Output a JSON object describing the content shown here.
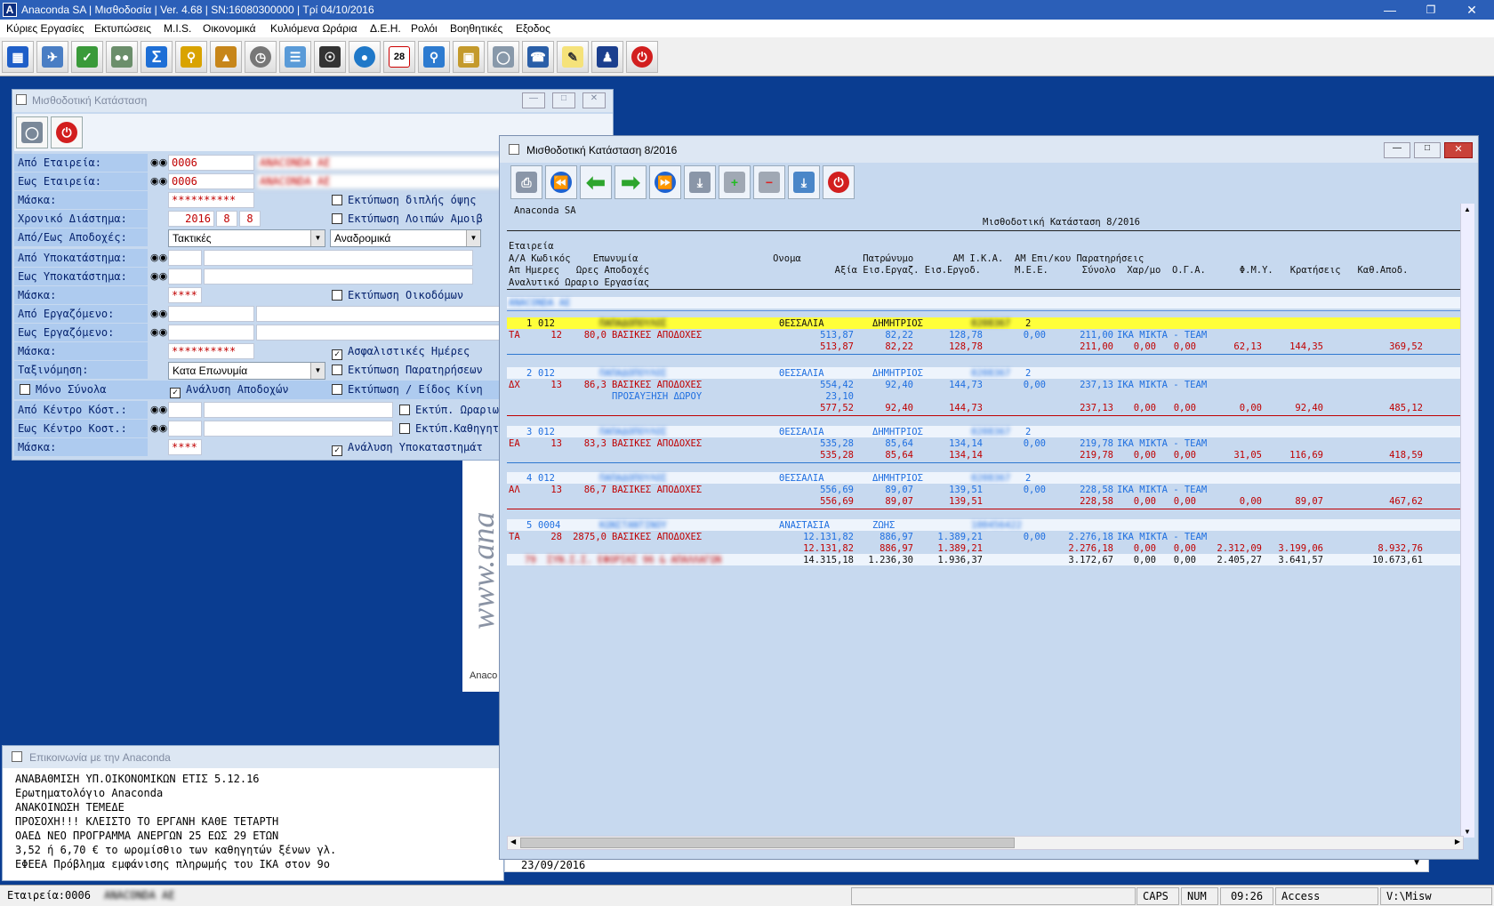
{
  "window": {
    "title": "Anaconda SA | Μισθοδοσία | Ver. 4.68 | SN:16080300000 | Τρί 04/10/2016",
    "app_icon": "A"
  },
  "menu": [
    "Κύριες Εργασίες",
    "Εκτυπώσεις",
    "M.I.S.",
    "Οικονομικά",
    "Κυλιόμενα Ωράρια",
    "Δ.Ε.Η.",
    "Ρολόι",
    "Βοηθητικές",
    "Εξοδος"
  ],
  "toolbar_icons": [
    "building-icon",
    "plane-icon",
    "checklist-icon",
    "users-icon",
    "sigma-icon",
    "key-icon",
    "pyramid-icon",
    "clock-icon",
    "book-icon",
    "headphones-icon",
    "globe-icon",
    "calendar-icon",
    "monitor-search-icon",
    "lock-icon",
    "database-globe-icon",
    "user-phone-icon",
    "notepad-icon",
    "stamp-user-icon",
    "power-icon"
  ],
  "calendar_day": "28",
  "form": {
    "title": "Μισθοδοτική Κατάσταση",
    "fields": {
      "from_company": {
        "label": "Από Εταιρεία:",
        "code": "0006",
        "name": "ANACONDA AE"
      },
      "to_company": {
        "label": "Εως Εταιρεία:",
        "code": "0006",
        "name": "ANACONDA AE"
      },
      "mask1": {
        "label": "Μάσκα:",
        "value": "**********"
      },
      "period": {
        "label": "Χρονικό Διάστημα:",
        "year": "2016",
        "m1": "8",
        "m2": "8"
      },
      "earnings": {
        "label": "Από/Εως Αποδοχές:",
        "sel1": "Τακτικές",
        "sel2": "Αναδρομικά"
      },
      "from_branch": {
        "label": "Από Υποκατάστημα:"
      },
      "to_branch": {
        "label": "Εως Υποκατάστημα:"
      },
      "mask2": {
        "label": "Μάσκα:",
        "value": "****"
      },
      "from_employee": {
        "label": "Από Εργαζόμενο:"
      },
      "to_employee": {
        "label": "Εως Εργαζόμενο:"
      },
      "mask3": {
        "label": "Μάσκα:",
        "value": "**********"
      },
      "sort": {
        "label": "Ταξινόμηση:",
        "value": "Κατα Επωνυμία"
      },
      "from_cost": {
        "label": "Από Κέντρο Κόστ.:"
      },
      "to_cost": {
        "label": "Εως Κέντρο Κοστ.:"
      },
      "mask4": {
        "label": "Μάσκα:",
        "value": "****"
      }
    },
    "checkboxes": {
      "double_side": "Εκτύπωση διπλής όψης",
      "other_pay": "Εκτύπωση Λοιπών Αμοιβ",
      "builders": "Εκτύπωση Οικοδόμων",
      "insurance_days": "Ασφαλιστικές Ημέρες",
      "remarks": "Εκτύπωση Παρατηρήσεων",
      "type_move": "Εκτύπωση / Είδος Κίνη",
      "only_totals": "Μόνο Σύνολα",
      "earnings_analysis": "Ανάλυση Αποδοχών",
      "schedules": "Εκτύπ. Ωραριω",
      "teachers": "Εκτύπ.Καθηγητ",
      "branch_analysis": "Ανάλυση Υποκαταστημάτ"
    },
    "logo_text": "www.ana",
    "logo_caption": "Anaco"
  },
  "comm": {
    "title": "Επικοινωνία με την Anaconda",
    "lines": [
      "ΑΝΑΒΑΘΜΙΣΗ ΥΠ.ΟΙΚΟΝΟΜΙΚΩΝ ΕΤΙΣ 5.12.16",
      "Ερωτηματολόγιο Anaconda",
      "ΑΝΑΚΟΙΝΩΣΗ ΤΕΜΕΔΕ",
      "ΠΡΟΣΟΧΗ!!! ΚΛΕΙΣΤΟ ΤΟ ΕΡΓΑΝΗ ΚΑΘΕ ΤΕΤΑΡΤΗ",
      "ΟΑΕΔ ΝΕΟ ΠΡΟΓΡΑΜΜΑ ΑΝΕΡΓΩΝ 25 ΕΩΣ 29 ΕΤΩΝ",
      "3,52 ή 6,70 € το ωρομίσθιο των καθηγητών ξένων γλ.",
      "ΕΦΕΕΑ Πρόβλημα εμφάνισης πληρωμής του ΙΚΑ στον 9ο"
    ],
    "date": "23/09/2016"
  },
  "report": {
    "title": "Μισθοδοτική Κατάσταση 8/2016",
    "company": "Anaconda SA",
    "heading": "Μισθοδοτική Κατάσταση 8/2016",
    "col_header_lines": [
      "Εταιρεία",
      "Α/Α Κωδικός    Επωνυμία                        Ονομα           Πατρώνυμο       ΑΜ Ι.Κ.Α.  ΑΜ Επι/κου Παρατηρήσεις",
      "Απ Ημερες   Ωρες Αποδοχές                                 Αξία Εισ.Εργαζ. Εισ.Εργοδ.      Μ.Ε.Ε.      Σύνολο  Χαρ/μο  Ο.Γ.Α.      Φ.Μ.Υ.   Κρατήσεις   Καθ.Αποδ.",
      "Αναλυτικό Ωραριο Εργασίας"
    ],
    "company_row": "ANACONDA AE",
    "records": [
      {
        "aa": "1",
        "code": "012",
        "surname": "ΠΑΠΑΔΟΠΟΥΛΟΣ",
        "name": "ΘΕΣΣΑΛΙΑ",
        "father": "ΔΗΜΗΤΡΙΟΣ",
        "ika": "0208367",
        "epi": "2",
        "lines": [
          {
            "ap": "ΤΑ",
            "days": "12",
            "hours": "80,0",
            "desc": "ΒΑΣΙΚΕΣ ΑΠΟΔΟΧΕΣ",
            "value": "513,87",
            "ee": "82,22",
            "er": "128,78",
            "mee": "0,00",
            "total": "211,00",
            "remark": "ΙΚΑ ΜΙΚΤΑ - TEAM"
          }
        ],
        "sum": {
          "value": "513,87",
          "ee": "82,22",
          "er": "128,78",
          "total": "211,00",
          "xar": "0,00",
          "oga": "0,00",
          "fmy": "62,13",
          "krat": "144,35",
          "kath": "369,52"
        }
      },
      {
        "aa": "2",
        "code": "012",
        "surname": "ΠΑΠΑΔΟΠΟΥΛΟΣ",
        "name": "ΘΕΣΣΑΛΙΑ",
        "father": "ΔΗΜΗΤΡΙΟΣ",
        "ika": "0208367",
        "epi": "2",
        "lines": [
          {
            "ap": "ΔΧ",
            "days": "13",
            "hours": "86,3",
            "desc": "ΒΑΣΙΚΕΣ ΑΠΟΔΟΧΕΣ",
            "value": "554,42",
            "ee": "92,40",
            "er": "144,73",
            "mee": "0,00",
            "total": "237,13",
            "remark": "ΙΚΑ ΜΙΚΤΑ - TEAM"
          },
          {
            "ap": "",
            "days": "",
            "hours": "",
            "desc": "ΠΡΟΣΑΥΞΗΣΗ ΔΩΡΟΥ",
            "value": "23,10",
            "ee": "",
            "er": "",
            "mee": "",
            "total": "",
            "remark": ""
          }
        ],
        "sum": {
          "value": "577,52",
          "ee": "92,40",
          "er": "144,73",
          "total": "237,13",
          "xar": "0,00",
          "oga": "0,00",
          "fmy": "0,00",
          "krat": "92,40",
          "kath": "485,12"
        }
      },
      {
        "aa": "3",
        "code": "012",
        "surname": "ΠΑΠΑΔΟΠΟΥΛΟΣ",
        "name": "ΘΕΣΣΑΛΙΑ",
        "father": "ΔΗΜΗΤΡΙΟΣ",
        "ika": "0208367",
        "epi": "2",
        "lines": [
          {
            "ap": "ΕΑ",
            "days": "13",
            "hours": "83,3",
            "desc": "ΒΑΣΙΚΕΣ ΑΠΟΔΟΧΕΣ",
            "value": "535,28",
            "ee": "85,64",
            "er": "134,14",
            "mee": "0,00",
            "total": "219,78",
            "remark": "ΙΚΑ ΜΙΚΤΑ - TEAM"
          }
        ],
        "sum": {
          "value": "535,28",
          "ee": "85,64",
          "er": "134,14",
          "total": "219,78",
          "xar": "0,00",
          "oga": "0,00",
          "fmy": "31,05",
          "krat": "116,69",
          "kath": "418,59"
        }
      },
      {
        "aa": "4",
        "code": "012",
        "surname": "ΠΑΠΑΔΟΠΟΥΛΟΣ",
        "name": "ΘΕΣΣΑΛΙΑ",
        "father": "ΔΗΜΗΤΡΙΟΣ",
        "ika": "0208367",
        "epi": "2",
        "lines": [
          {
            "ap": "ΑΛ",
            "days": "13",
            "hours": "86,7",
            "desc": "ΒΑΣΙΚΕΣ ΑΠΟΔΟΧΕΣ",
            "value": "556,69",
            "ee": "89,07",
            "er": "139,51",
            "mee": "0,00",
            "total": "228,58",
            "remark": "ΙΚΑ ΜΙΚΤΑ - TEAM"
          }
        ],
        "sum": {
          "value": "556,69",
          "ee": "89,07",
          "er": "139,51",
          "total": "228,58",
          "xar": "0,00",
          "oga": "0,00",
          "fmy": "0,00",
          "krat": "89,07",
          "kath": "467,62"
        }
      },
      {
        "aa": "5",
        "code": "0004",
        "surname": "ΚΩΝΣΤΑΝΤΙΝΟΥ",
        "name": "ΑΝΑΣΤΑΣΙΑ",
        "father": "ΖΩΗΣ",
        "ika": "100456422",
        "epi": "",
        "lines": [
          {
            "ap": "ΤΑ",
            "days": "28",
            "hours": "2875,0",
            "desc": "ΒΑΣΙΚΕΣ ΑΠΟΔΟΧΕΣ",
            "value": "12.131,82",
            "ee": "886,97",
            "er": "1.389,21",
            "mee": "0,00",
            "total": "2.276,18",
            "remark": "ΙΚΑ ΜΙΚΤΑ - TEAM"
          }
        ],
        "sum": {
          "value": "12.131,82",
          "ee": "886,97",
          "er": "1.389,21",
          "total": "2.276,18",
          "xar": "0,00",
          "oga": "0,00",
          "fmy": "2.312,09",
          "krat": "3.199,06",
          "kath": "8.932,76"
        }
      }
    ],
    "grand": {
      "label": "79  ΣΥΝ.Σ.Σ. ΕΦΟΡΙΑΣ 96 & ΑΠΑΛΛΑΓΩΝ",
      "value": "14.315,18",
      "ee": "1.236,30",
      "er": "1.936,37",
      "total": "3.172,67",
      "xar": "0,00",
      "oga": "0,00",
      "fmy": "2.405,27",
      "krat": "3.641,57",
      "kath": "10.673,61"
    }
  },
  "status": {
    "company": "Εταιρεία:0006",
    "company_name": "ANACONDA AE",
    "caps": "CAPS",
    "num": "NUM",
    "time": "09:26",
    "access": "Access",
    "path": "V:\\Misw"
  }
}
